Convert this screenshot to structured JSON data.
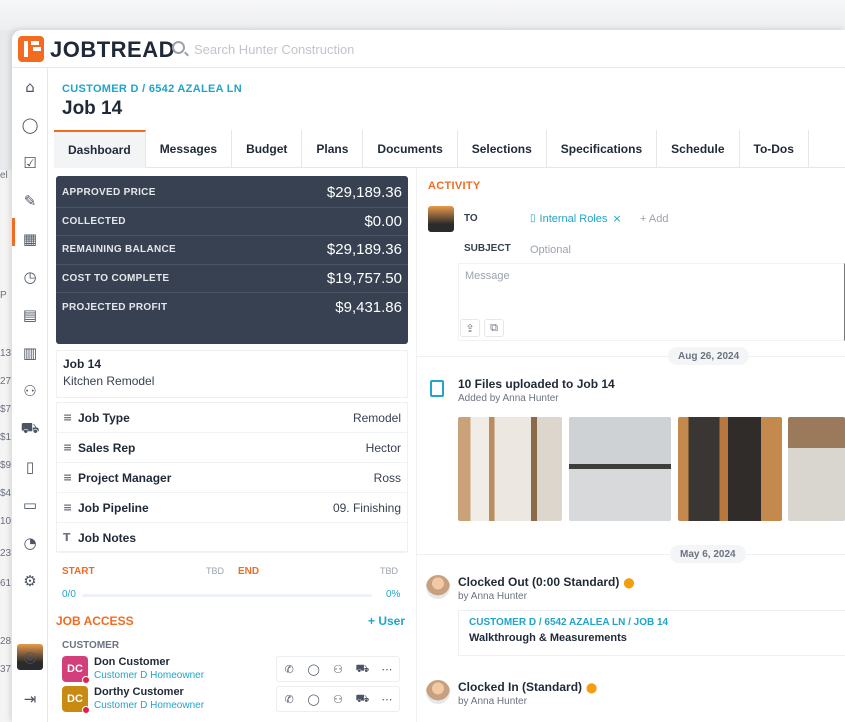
{
  "app": {
    "logo_text": "JOBTREAD"
  },
  "search": {
    "placeholder": "Search Hunter Construction"
  },
  "background_left_fragments": [
    "el",
    "P",
    "13",
    "27",
    "$7",
    "$1",
    "$9",
    "$4",
    "10",
    "23",
    "61",
    "28",
    "37"
  ],
  "sidebar": {
    "icons": [
      "home-icon",
      "chat-icon",
      "checkbox-icon",
      "wrench-icon",
      "calendar-icon",
      "clock-icon",
      "clipboard-icon",
      "document-icon",
      "users-icon",
      "truck-icon",
      "book-icon",
      "folder-icon",
      "pie-chart-icon",
      "gear-icon",
      "avatar",
      "lifebuoy-icon",
      "logout-icon"
    ]
  },
  "page": {
    "breadcrumb": "CUSTOMER D / 6542 AZALEA LN",
    "title": "Job 14"
  },
  "tabs": [
    {
      "label": "Dashboard",
      "active": true
    },
    {
      "label": "Messages"
    },
    {
      "label": "Budget"
    },
    {
      "label": "Plans"
    },
    {
      "label": "Documents"
    },
    {
      "label": "Selections"
    },
    {
      "label": "Specifications"
    },
    {
      "label": "Schedule"
    },
    {
      "label": "To-Dos"
    }
  ],
  "financials": [
    {
      "label": "APPROVED PRICE",
      "value": "$29,189.36"
    },
    {
      "label": "COLLECTED",
      "value": "$0.00"
    },
    {
      "label": "REMAINING BALANCE",
      "value": "$29,189.36"
    },
    {
      "label": "COST TO COMPLETE",
      "value": "$19,757.50"
    },
    {
      "label": "PROJECTED PROFIT",
      "value": "$9,431.86"
    }
  ],
  "job": {
    "name": "Job 14",
    "description": "Kitchen Remodel"
  },
  "fields": [
    {
      "icon": "list-icon",
      "glyph": "≡",
      "label": "Job Type",
      "value": "Remodel"
    },
    {
      "icon": "list-icon",
      "glyph": "≡",
      "label": "Sales Rep",
      "value": "Hector"
    },
    {
      "icon": "list-icon",
      "glyph": "≡",
      "label": "Project Manager",
      "value": "Ross"
    },
    {
      "icon": "list-icon",
      "glyph": "≡",
      "label": "Job Pipeline",
      "value": "09. Finishing"
    },
    {
      "icon": "text-icon",
      "glyph": "T",
      "label": "Job Notes",
      "value": ""
    }
  ],
  "schedule": {
    "start_label": "START",
    "start_value": "TBD",
    "end_label": "END",
    "end_value": "TBD",
    "count": "0/0",
    "percent": "0%",
    "progress": 0
  },
  "access": {
    "title": "JOB ACCESS",
    "add_label": "+ User",
    "group_label": "CUSTOMER",
    "contacts": [
      {
        "initials": "DC",
        "name": "Don Customer",
        "role": "Customer D Homeowner",
        "color": "#d23f7a"
      },
      {
        "initials": "DC",
        "name": "Dorthy Customer",
        "role": "Customer D Homeowner",
        "color": "#c98a12"
      }
    ],
    "actions": [
      "phone-icon",
      "chat-icon",
      "users-icon",
      "truck-icon",
      "more-icon"
    ]
  },
  "activity": {
    "title": "ACTIVITY",
    "to_label": "TO",
    "recipient": "Internal Roles",
    "add_label": "+ Add",
    "subject_label": "SUBJECT",
    "subject_placeholder": "Optional",
    "message_placeholder": "Message",
    "date1": "Aug 26, 2024",
    "files_event": {
      "title": "10 Files uploaded to Job 14",
      "by": "Added by Anna Hunter"
    },
    "date2": "May 6, 2024",
    "clock_out": {
      "title": "Clocked Out (0:00 Standard)",
      "by": "by Anna Hunter"
    },
    "task": {
      "breadcrumb": "CUSTOMER D / 6542 AZALEA LN / JOB 14",
      "title": "Walkthrough & Measurements"
    },
    "clock_in": {
      "title": "Clocked In (Standard)",
      "by": "by Anna Hunter"
    }
  },
  "colors": {
    "accent_orange": "#f26b21",
    "link_teal": "#20a4c8",
    "fin_panel": "#374151"
  }
}
